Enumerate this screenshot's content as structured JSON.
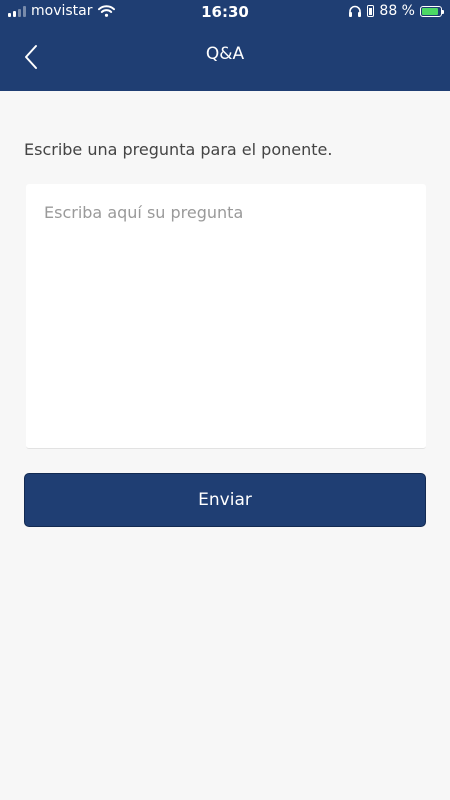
{
  "status_bar": {
    "carrier": "movistar",
    "time": "16:30",
    "battery_percent": "88 %",
    "battery_level": 0.88
  },
  "nav": {
    "title": "Q&A"
  },
  "form": {
    "prompt": "Escribe una pregunta para el ponente.",
    "placeholder": "Escriba aquí su pregunta",
    "submit_label": "Enviar"
  },
  "colors": {
    "header_bg": "#1f3e73",
    "button_bg": "#1f3e73",
    "page_bg": "#f7f7f7",
    "battery_fill": "#4cd964"
  },
  "icons": {
    "signal": "signal-icon",
    "wifi": "wifi-icon",
    "headphones": "headphones-icon",
    "lock": "orientation-lock-icon",
    "battery": "battery-charging-icon",
    "back": "chevron-left-icon"
  }
}
